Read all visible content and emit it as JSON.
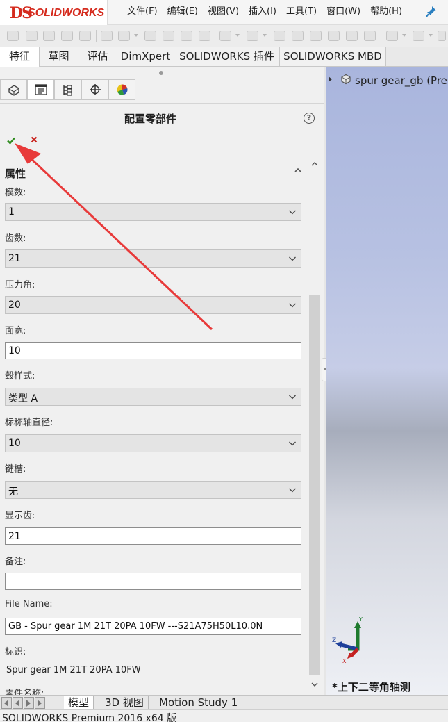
{
  "app": {
    "brand": "SOLIDWORKS",
    "brand_mark": "DS",
    "brand_color": "#d52b1e"
  },
  "menu": [
    {
      "label": "文件(F)"
    },
    {
      "label": "编辑(E)"
    },
    {
      "label": "视图(V)"
    },
    {
      "label": "插入(I)"
    },
    {
      "label": "工具(T)"
    },
    {
      "label": "窗口(W)"
    },
    {
      "label": "帮助(H)"
    }
  ],
  "command_tabs": [
    {
      "label": "特征"
    },
    {
      "label": "草图"
    },
    {
      "label": "评估"
    },
    {
      "label": "DimXpert"
    },
    {
      "label": "SOLIDWORKS 插件"
    },
    {
      "label": "SOLIDWORKS MBD"
    }
  ],
  "manager_tabs": [
    {
      "icon": "featuremanager-icon"
    },
    {
      "icon": "propertymanager-icon"
    },
    {
      "icon": "configurationmanager-icon"
    },
    {
      "icon": "dimxpertmanager-icon"
    },
    {
      "icon": "displaymanager-icon"
    }
  ],
  "property_manager": {
    "title": "配置零部件",
    "group_title": "属性",
    "fields": [
      {
        "label": "模数:",
        "type": "dropdown",
        "value": "1"
      },
      {
        "label": "齿数:",
        "type": "dropdown",
        "value": "21"
      },
      {
        "label": "压力角:",
        "type": "dropdown",
        "value": "20"
      },
      {
        "label": "面宽:",
        "type": "text",
        "value": "10"
      },
      {
        "label": "毂样式:",
        "type": "dropdown",
        "value": "类型 A"
      },
      {
        "label": "标称轴直径:",
        "type": "dropdown",
        "value": "10"
      },
      {
        "label": "键槽:",
        "type": "dropdown",
        "value": "无"
      },
      {
        "label": "显示齿:",
        "type": "text",
        "value": "21"
      },
      {
        "label": "备注:",
        "type": "text",
        "value": ""
      },
      {
        "label": "File Name:",
        "type": "text",
        "value": "GB - Spur gear 1M 21T 20PA 10FW ---S21A75H50L10.0N"
      },
      {
        "label": "标识:",
        "type": "static",
        "value": "Spur gear 1M 21T 20PA 10FW"
      },
      {
        "label": "零件名称:",
        "type": "label",
        "value": ""
      }
    ]
  },
  "viewport": {
    "tree_item": "spur gear_gb  (Pre",
    "view_name": "*上下二等角轴测",
    "triad": {
      "x": "X",
      "y": "Y",
      "z": "Z"
    }
  },
  "bottom_tabs": [
    {
      "label": "模型"
    },
    {
      "label": "3D 视图"
    },
    {
      "label": "Motion Study 1"
    }
  ],
  "status": "SOLIDWORKS Premium 2016 x64 版",
  "colors": {
    "ok": "#2e8b1e",
    "cancel": "#c8201a",
    "annotation_arrow": "#e83a3a"
  }
}
